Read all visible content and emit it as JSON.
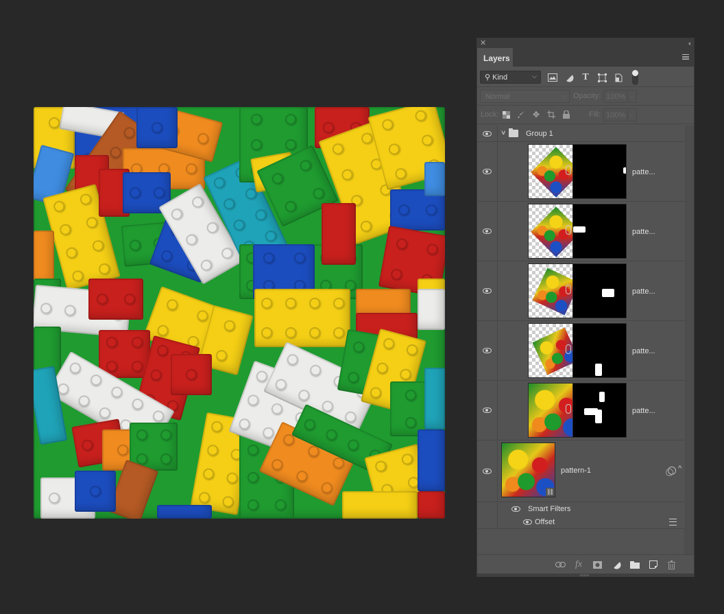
{
  "canvas": {
    "description": "Seamless pattern of colorful toy building bricks",
    "colors": {
      "yellow": "#f4cf15",
      "red": "#c8201d",
      "green": "#1f9b30",
      "blue": "#1c4dbf",
      "orange": "#f08b1f",
      "white": "#ececea",
      "teal": "#1fa3b8",
      "brown": "#b55a24",
      "lightblue": "#3f8ce0"
    }
  },
  "panel": {
    "close_icon": "close-icon",
    "collapse_icon": "collapse-double-chevron-icon",
    "tab_label": "Layers",
    "menu_icon": "hamburger-menu-icon",
    "filter": {
      "kind_label": "Kind",
      "icons": [
        "image-filter-icon",
        "adjustment-filter-icon",
        "type-filter-icon",
        "shape-filter-icon",
        "smart-object-filter-icon"
      ],
      "type_glyph": "T"
    },
    "blend_mode": "Normal",
    "opacity_label": "Opacity:",
    "opacity_value": "100%",
    "lock_label": "Lock:",
    "fill_label": "Fill:",
    "fill_value": "100%"
  },
  "layers": {
    "group": {
      "name": "Group 1",
      "expanded": true,
      "visible": true
    },
    "children": [
      {
        "name": "patte...",
        "visible": true,
        "mask": "small white spot at right edge"
      },
      {
        "name": "patte...",
        "visible": true,
        "mask": "white blob at left"
      },
      {
        "name": "patte...",
        "visible": true,
        "mask": "white rectangle center"
      },
      {
        "name": "patte...",
        "visible": true,
        "mask": "white rectangle bottom"
      },
      {
        "name": "patte...",
        "visible": true,
        "mask": "white shapes center"
      }
    ],
    "base": {
      "name": "pattern-1",
      "visible": true,
      "smart_filters_label": "Smart Filters",
      "filters": [
        {
          "name": "Offset",
          "visible": true
        }
      ]
    }
  },
  "bottom_bar": {
    "icons": [
      "link-layers-icon",
      "fx-icon",
      "add-mask-icon",
      "adjustment-layer-icon",
      "new-group-icon",
      "new-layer-icon",
      "delete-icon"
    ],
    "fx_label": "fx"
  }
}
